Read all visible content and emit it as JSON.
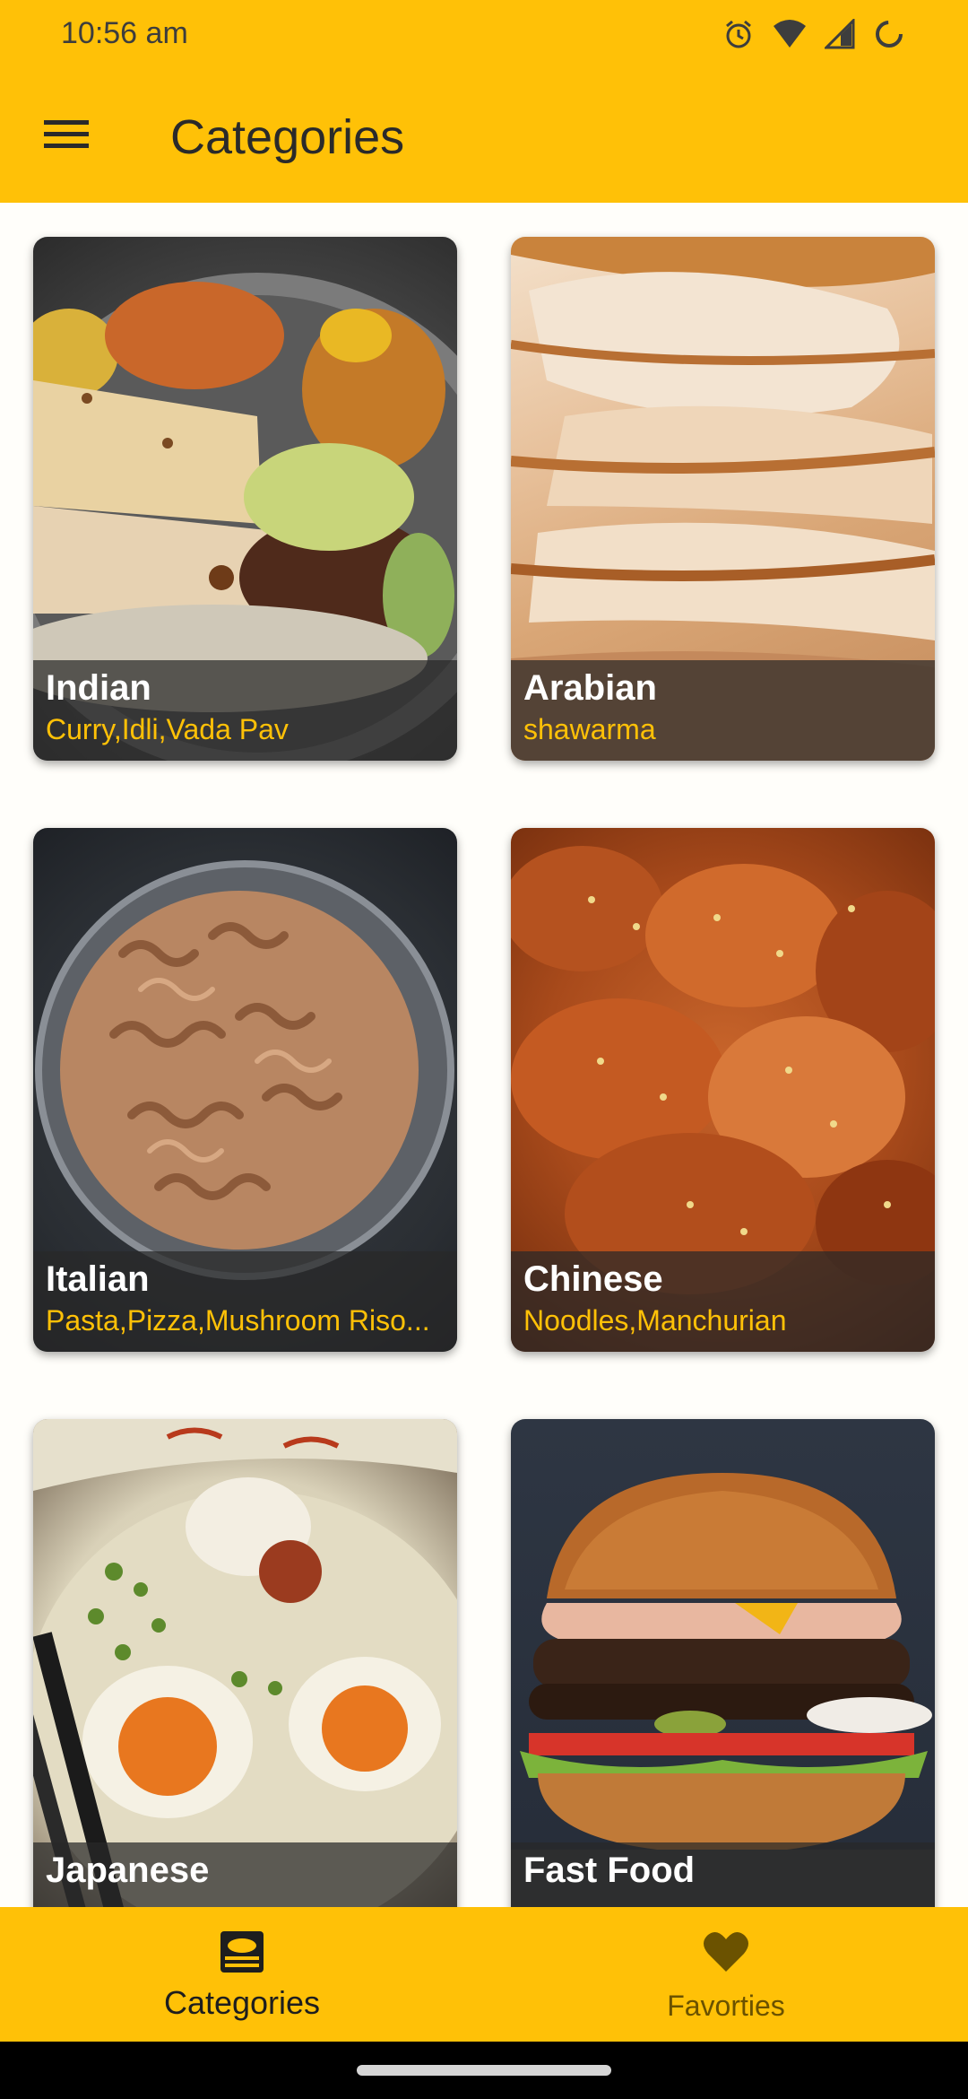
{
  "status_bar": {
    "time": "10:56 am"
  },
  "app_bar": {
    "title": "Categories"
  },
  "categories": [
    {
      "name": "Indian",
      "items": "Curry,Idli,Vada Pav"
    },
    {
      "name": "Arabian",
      "items": "shawarma"
    },
    {
      "name": "Italian",
      "items": "Pasta,Pizza,Mushroom Riso..."
    },
    {
      "name": "Chinese",
      "items": "Noodles,Manchurian"
    },
    {
      "name": "Japanese",
      "items": ""
    },
    {
      "name": "Fast Food",
      "items": ""
    }
  ],
  "bottom_nav": {
    "items": [
      {
        "label": "Categories",
        "icon": "category-dish-icon",
        "selected": true
      },
      {
        "label": "Favorties",
        "icon": "heart-icon",
        "selected": false
      }
    ]
  },
  "colors": {
    "accent": "#FFC107",
    "caption_overlay": "#282828",
    "item_text": "#FFC107"
  }
}
